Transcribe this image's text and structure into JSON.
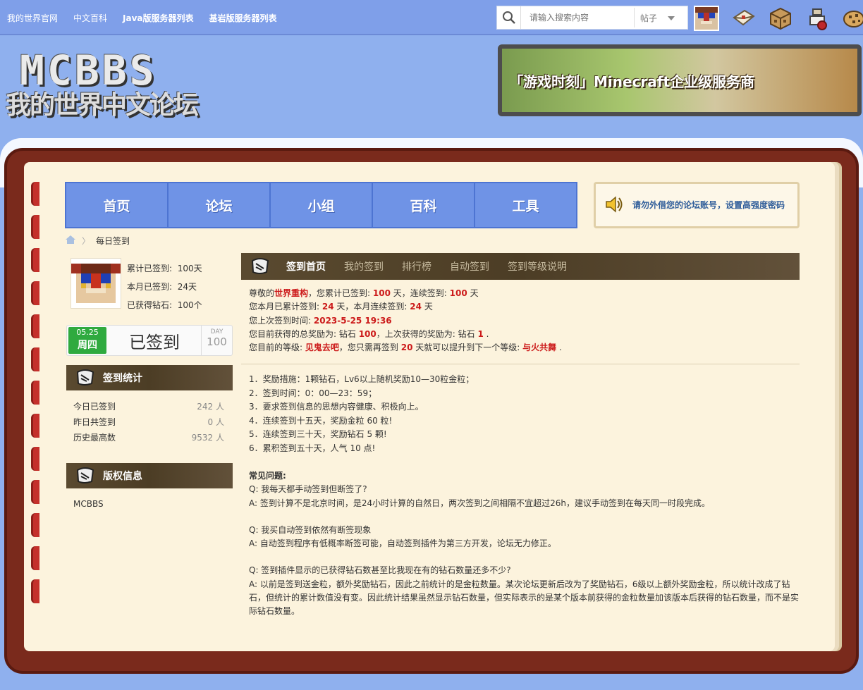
{
  "topnav": {
    "items": [
      "我的世界官网",
      "中文百科",
      "Java版服务器列表",
      "基岩版服务器列表"
    ]
  },
  "search": {
    "placeholder": "请输入搜索内容",
    "type_label": "帖子"
  },
  "logo": {
    "line1": "MCBBS",
    "line2": "我的世界中文论坛"
  },
  "banner": {
    "text": "「游戏时刻」Minecraft企业级服务商"
  },
  "mainnav": {
    "items": [
      "首页",
      "论坛",
      "小组",
      "百科",
      "工具"
    ]
  },
  "notice": {
    "text": "请勿外借您的论坛账号，设置高强度密码"
  },
  "breadcrumb": {
    "current": "每日签到"
  },
  "user": {
    "total_label": "累计已签到:",
    "total_value": "100天",
    "month_label": "本月已签到:",
    "month_value": "24天",
    "diamond_label": "已获得钻石:",
    "diamond_value": "100个"
  },
  "signbox": {
    "date": "05.25",
    "weekday": "周四",
    "status": "已签到",
    "day_label": "DAY",
    "day_value": "100"
  },
  "stats": {
    "title": "签到统计",
    "rows": [
      {
        "label": "今日已签到",
        "value": "242 人"
      },
      {
        "label": "昨日共签到",
        "value": "0 人"
      },
      {
        "label": "历史最高数",
        "value": "9532 人"
      }
    ]
  },
  "copyright": {
    "title": "版权信息",
    "text": "MCBBS"
  },
  "tabs": [
    "签到首页",
    "我的签到",
    "排行榜",
    "自动签到",
    "签到等级说明"
  ],
  "info": {
    "l1_a": "尊敬的",
    "username": "世界重构",
    "l1_b": "，您累计已签到:",
    "l1_total": "100",
    "l1_c": "天，连续签到:",
    "l1_cont": "100",
    "l1_d": "天",
    "l2_a": "您本月已累计签到:",
    "l2_month": "24",
    "l2_b": "天，本月连续签到:",
    "l2_mcont": "24",
    "l2_c": "天",
    "l3_a": "您上次签到时间:",
    "l3_time": "2023-5-25 19:36",
    "l4_a": "您目前获得的总奖励为: 钻石",
    "l4_total": "100",
    "l4_b": "，上次获得的奖励为: 钻石",
    "l4_last": "1",
    "l4_c": ".",
    "l5_a": "您目前的等级:",
    "l5_level": "见鬼去吧",
    "l5_b": "，您只需再签到",
    "l5_days": "20",
    "l5_c": "天就可以提升到下一个等级:",
    "l5_next": "与火共舞",
    "l5_d": "."
  },
  "rules": [
    "1．奖励措施：1颗钻石，Lv6以上随机奖励10—30粒金粒；",
    "2．签到时间：0：00—23：59；",
    "3．要求签到信息的思想内容健康、积极向上。",
    "4．连续签到十五天，奖励金粒 60 粒!",
    "5．连续签到三十天，奖励钻石 5 颗!",
    "6．累积签到五十天，人气 10 点!"
  ],
  "faq": {
    "title": "常见问题:",
    "q1": "Q:  我每天都手动签到但断签了?",
    "a1": "A:  签到计算不是北京时间，是24小时计算的自然日，两次签到之间相隔不宜超过26h，建议手动签到在每天同一时段完成。",
    "q2": "Q:  我买自动签到依然有断签现象",
    "a2": "A:  自动签到程序有低概率断签可能，自动签到插件为第三方开发，论坛无力修正。",
    "q3": "Q:  签到插件显示的已获得钻石数甚至比我现在有的钻石数量还多不少?",
    "a3": "A:  以前是签到送金粒，额外奖励钻石，因此之前统计的是金粒数量。某次论坛更新后改为了奖励钻石，6级以上额外奖励金粒，所以统计改成了钻石，但统计的累计数值没有变。因此统计结果虽然显示钻石数量，但实际表示的是某个版本前获得的金粒数量加该版本后获得的钻石数量，而不是实际钻石数量。"
  }
}
